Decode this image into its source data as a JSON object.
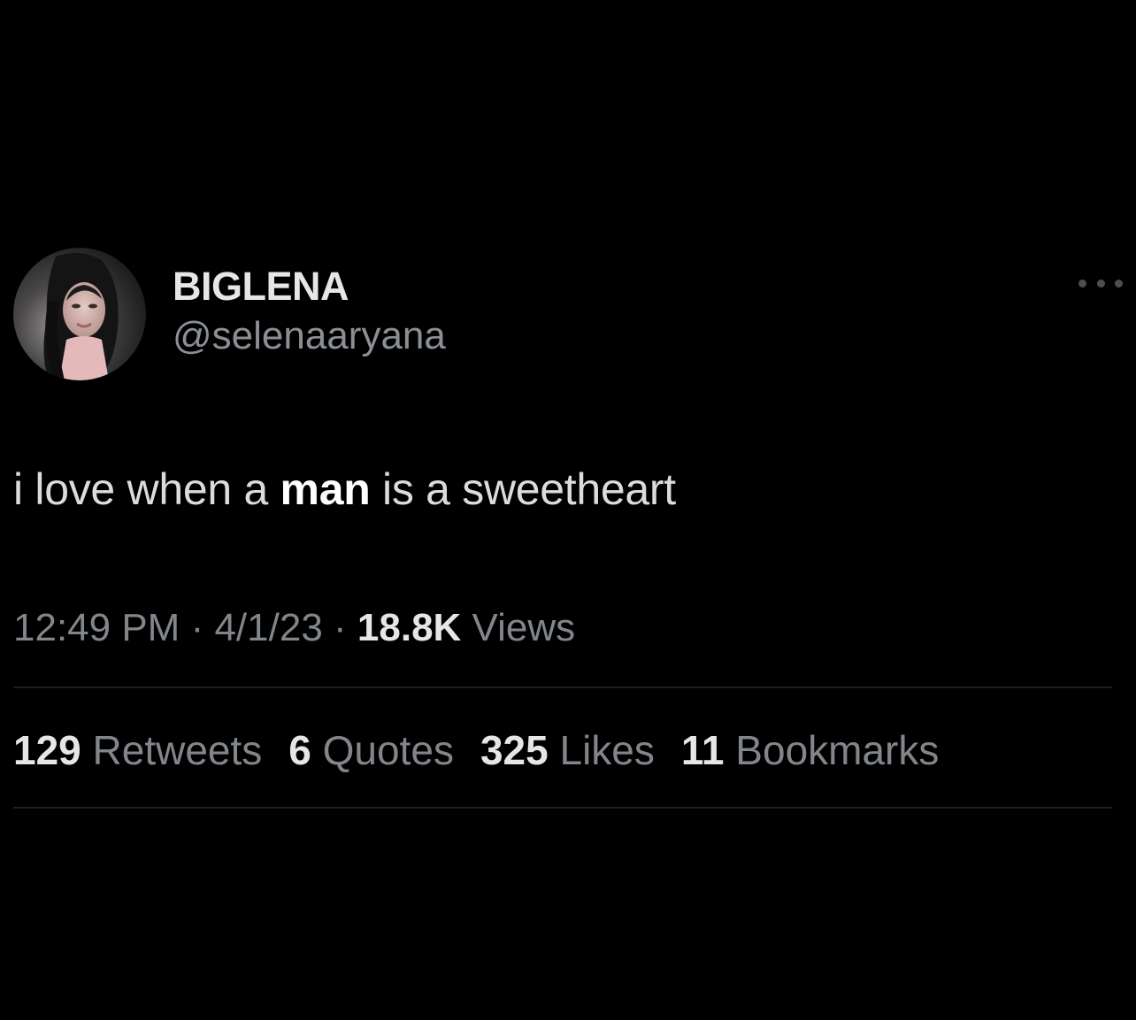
{
  "author": {
    "display_name": "BIGLENA",
    "handle": "@selenaaryana"
  },
  "tweet": {
    "text_before": "i love when a ",
    "text_bold": "man",
    "text_after": " is a sweetheart"
  },
  "meta": {
    "time": "12:49 PM",
    "separator1": " · ",
    "date": "4/1/23",
    "separator2": " · ",
    "views_count": "18.8K",
    "views_label": " Views"
  },
  "stats": [
    {
      "count": "129",
      "label": " Retweets"
    },
    {
      "count": "6",
      "label": " Quotes"
    },
    {
      "count": "325",
      "label": " Likes"
    },
    {
      "count": "11",
      "label": " Bookmarks"
    }
  ],
  "icons": {
    "more": "more-horizontal-icon"
  },
  "colors": {
    "background": "#000000",
    "primary_text": "#e6e6e6",
    "secondary_text": "#82868b",
    "divider": "#1c1e21"
  }
}
